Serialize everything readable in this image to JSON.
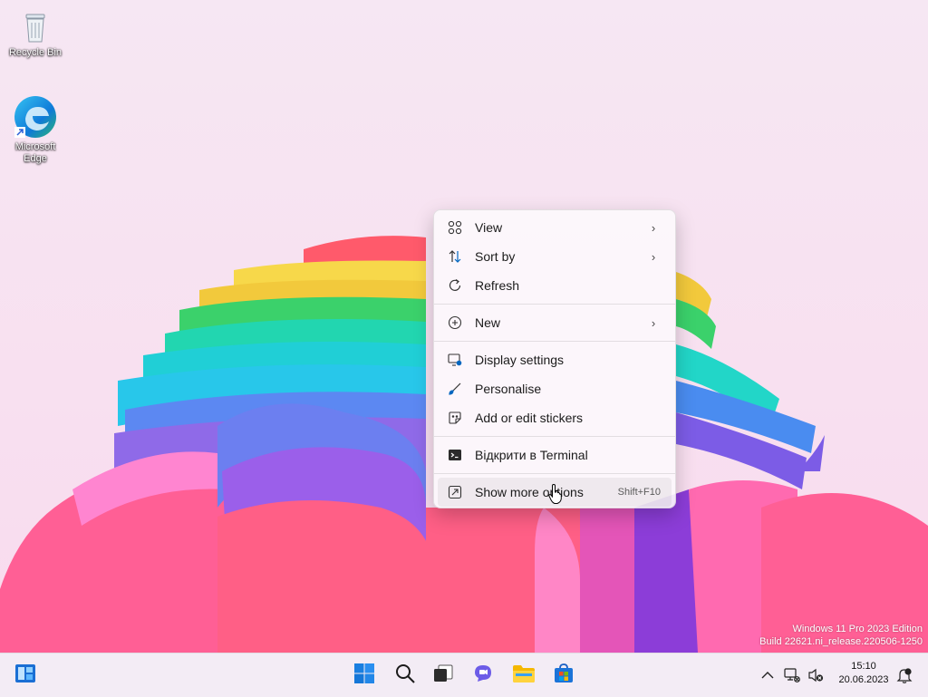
{
  "desktop": {
    "icons": [
      {
        "label": "Recycle Bin",
        "icon": "recycle-bin-icon"
      },
      {
        "label": "Microsoft Edge",
        "icon": "edge-icon"
      }
    ],
    "watermark": {
      "line1": "Windows 11 Pro 2023 Edition",
      "line2": "Build 22621.ni_release.220506-1250"
    }
  },
  "context_menu": {
    "items": [
      {
        "label": "View",
        "icon": "grid-icon",
        "submenu": true
      },
      {
        "label": "Sort by",
        "icon": "sort-icon",
        "submenu": true
      },
      {
        "label": "Refresh",
        "icon": "refresh-icon"
      },
      {
        "label": "New",
        "icon": "plus-circle-icon",
        "submenu": true
      },
      {
        "label": "Display settings",
        "icon": "display-icon"
      },
      {
        "label": "Personalise",
        "icon": "brush-icon"
      },
      {
        "label": "Add or edit stickers",
        "icon": "sticker-icon"
      },
      {
        "label": "Відкрити в Terminal",
        "icon": "terminal-icon"
      },
      {
        "label": "Show more options",
        "icon": "more-options-icon",
        "shortcut": "Shift+F10",
        "hovered": true
      }
    ]
  },
  "taskbar": {
    "widgets_icon": "widgets-icon",
    "pinned": [
      "start-icon",
      "search-icon",
      "task-view-icon",
      "teams-chat-icon",
      "file-explorer-icon",
      "store-icon"
    ],
    "tray": {
      "icons": [
        "chevron-up-icon",
        "network-icon",
        "speaker-muted-icon",
        "notification-icon"
      ],
      "time": "15:10",
      "date": "20.06.2023"
    }
  },
  "colors": {
    "accent": "#0067c0",
    "menu_bg": "#fcf8fc",
    "taskbar_bg": "#f3ecf5"
  }
}
